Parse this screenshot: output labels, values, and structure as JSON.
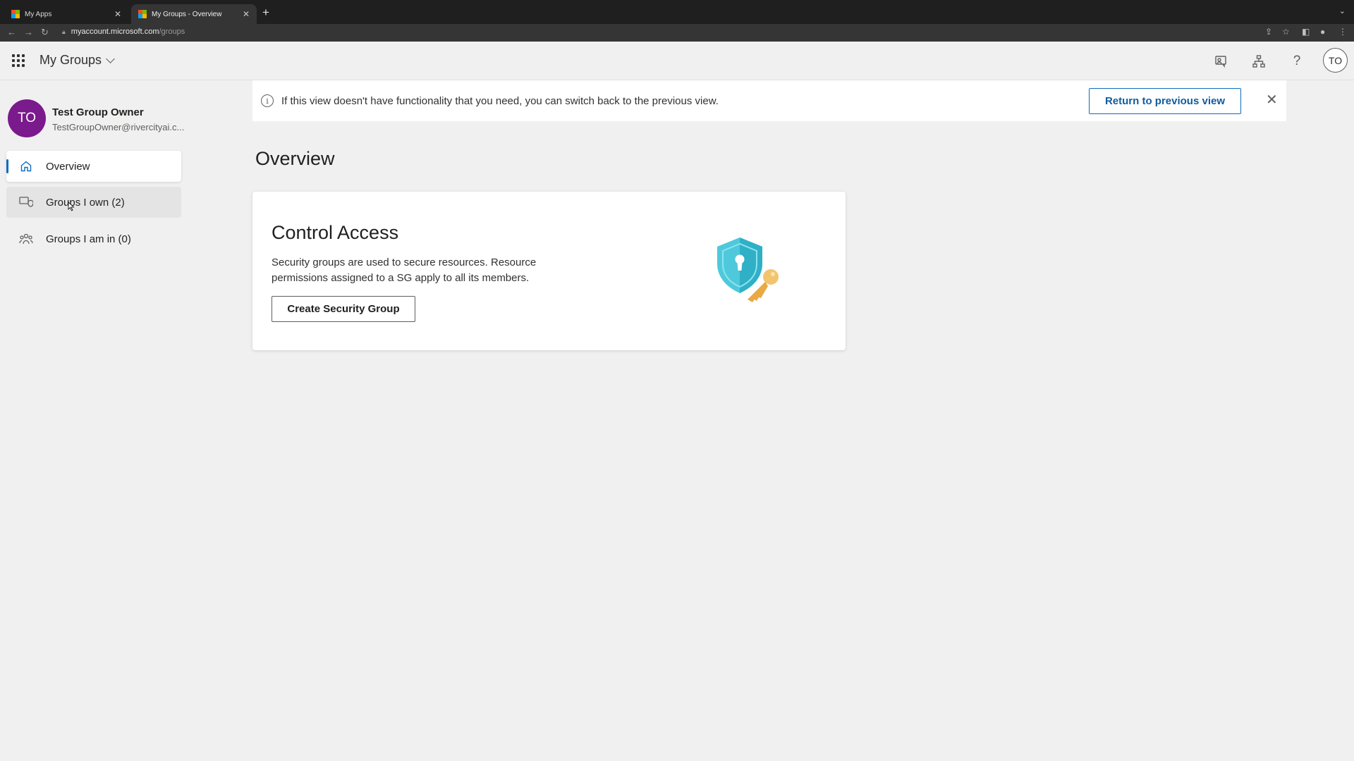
{
  "browser": {
    "tabs": [
      {
        "label": "My Apps",
        "active": false
      },
      {
        "label": "My Groups - Overview",
        "active": true
      }
    ],
    "url_host": "myaccount.microsoft.com",
    "url_path": "/groups"
  },
  "header": {
    "app_title": "My Groups",
    "avatar_initials": "TO",
    "icons": [
      "feedback-icon",
      "org-chart-icon",
      "help-icon"
    ]
  },
  "profile": {
    "initials": "TO",
    "name": "Test Group Owner",
    "email": "TestGroupOwner@rivercityai.c..."
  },
  "sidebar": {
    "items": [
      {
        "label": "Overview",
        "icon": "home-icon",
        "active": true
      },
      {
        "label": "Groups I own (2)",
        "icon": "shield-group-icon",
        "active": false
      },
      {
        "label": "Groups I am in (0)",
        "icon": "people-icon",
        "active": false
      }
    ]
  },
  "banner": {
    "message": "If this view doesn't have functionality that you need, you can switch back to the previous view.",
    "button_label": "Return to previous view"
  },
  "main": {
    "title": "Overview",
    "card": {
      "title": "Control Access",
      "description": "Security groups are used to secure resources. Resource permissions assigned to a SG apply to all its members.",
      "button_label": "Create Security Group"
    }
  },
  "colors": {
    "avatar_purple": "#7a1a8c",
    "accent_blue": "#0f6cbd",
    "shield_teal": "#4ec9dc",
    "key_gold": "#f2c46d"
  }
}
